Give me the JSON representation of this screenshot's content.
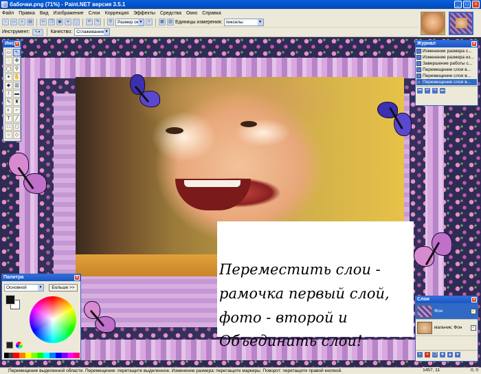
{
  "window": {
    "title": "бабочки.png (71%) - Paint.NET версия 3.5.1",
    "min": "_",
    "max": "□",
    "close": "×"
  },
  "menu": [
    "Файл",
    "Правка",
    "Вид",
    "Изображение",
    "Слои",
    "Коррекция",
    "Эффекты",
    "Средства",
    "Окно",
    "Справка"
  ],
  "toolbar": {
    "zoom_combo": "Размер окна",
    "units_label": "Единицы измерения:",
    "units_value": "пикселы"
  },
  "tooloptions": {
    "tool_label": "Инструмент:",
    "quality_label": "Качество:",
    "quality_value": "Сглаживание"
  },
  "tools_panel": {
    "title": "Инс..."
  },
  "history_panel": {
    "title": "Журнал",
    "items": [
      "Изменение размера с...",
      "Изменение размера из...",
      "Завершение работы с...",
      "Перемещение слоя в...",
      "Перемещение слоя в...",
      "Перемещение слоя в..."
    ],
    "selected_index": 5
  },
  "palette_panel": {
    "title": "Палитра",
    "mode": "Основной",
    "more_button": "Больше >>"
  },
  "layers_panel": {
    "title": "Слои",
    "layers": [
      {
        "name": "Фон",
        "visible": true
      },
      {
        "name": "мальчик; Фон",
        "visible": true
      }
    ],
    "selected_index": 0,
    "check": "✓"
  },
  "overlay_text": [
    "Переместить слои -",
    "рамочка первый слой,",
    "фото - второй и",
    " Объединить слои!"
  ],
  "status": {
    "hint": "Перемещение выделенной области. Перемещение: перетащите выделенное. Изменение размера: перетащите маркеры. Поворот: перетащите правой кнопкой.",
    "coords": "1457, 11",
    "selection": "0, 0"
  },
  "colors": {
    "titlebar": "#0a5fd8",
    "selection": "#316ac5",
    "chrome": "#ece9d8"
  }
}
